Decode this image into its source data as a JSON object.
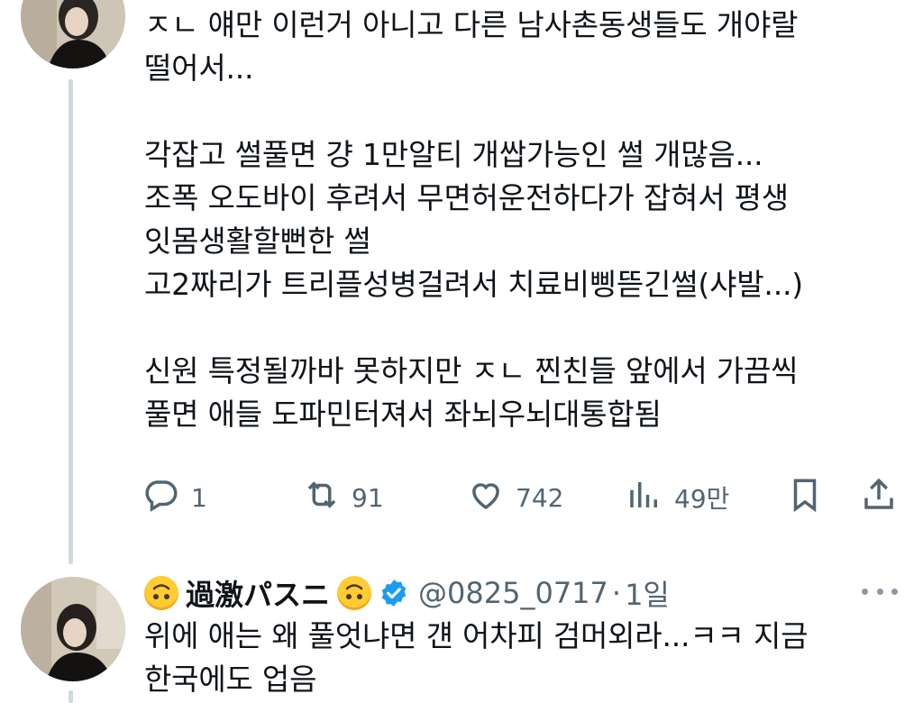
{
  "tweet1": {
    "lines": [
      "ㅈㄴ 얘만 이런거 아니고 다른 남사촌동생들도 개야랄",
      "떨어서...",
      "",
      "각잡고 썰풀면 걍 1만알티 개쌉가능인 썰 개많음...",
      "조폭 오도바이 후려서 무면허운전하다가 잡혀서 평생",
      "잇몸생활할뻔한 썰",
      "고2짜리가 트리플성병걸려서 치료비삥뜯긴썰(샤발...)",
      "",
      "신원 특정될까바 못하지만 ㅈㄴ 찐친들 앞에서 가끔씩",
      "풀면 애들 도파민터져서 좌뇌우뇌대통합됨"
    ],
    "actions": {
      "reply_count": "1",
      "retweet_count": "91",
      "like_count": "742",
      "views_count": "49만"
    },
    "icons": [
      "reply-icon",
      "retweet-icon",
      "like-icon",
      "views-icon",
      "bookmark-icon",
      "share-icon"
    ]
  },
  "tweet2": {
    "display_name": "過激パスニ",
    "handle": "@0825_0717",
    "dot": "·",
    "time": "1일",
    "lines": [
      "위에 애는 왜 풀엇냐면 걘 어차피 검머외라...ㅋㅋ 지금",
      "한국에도 업음"
    ]
  },
  "colors": {
    "text": "#0f1419",
    "secondary": "#536471",
    "thread_line": "#cfd9de",
    "verified": "#1d9bf0",
    "emoji": "#ffcc33"
  }
}
